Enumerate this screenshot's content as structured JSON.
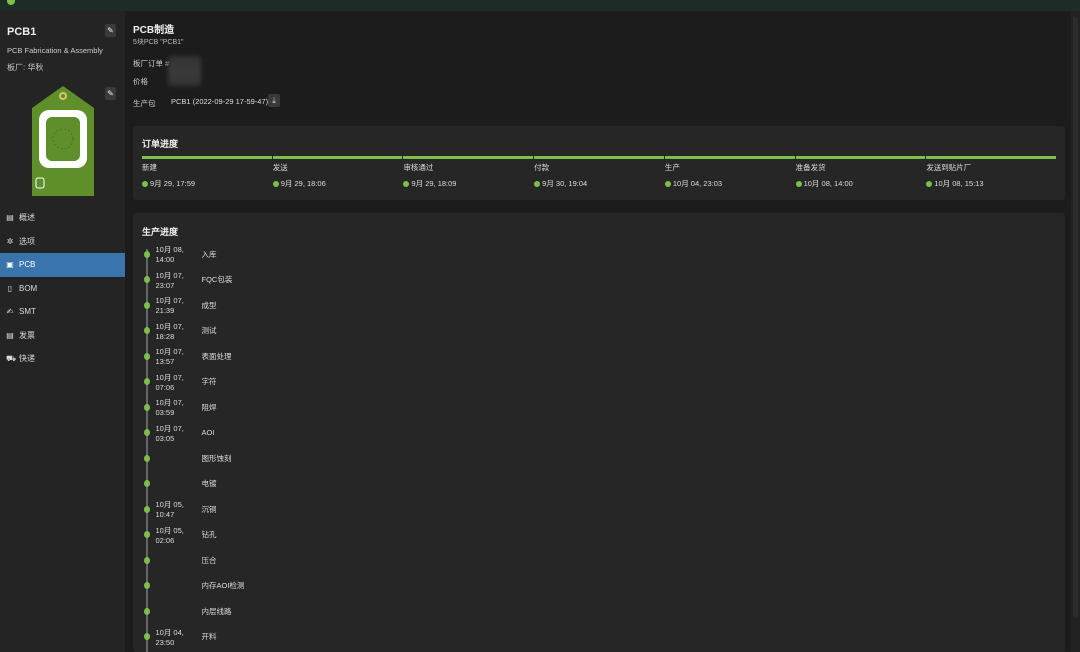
{
  "sidebar": {
    "title": "PCB1",
    "subtitle": "PCB Fabrication & Assembly",
    "fab": "板厂: 华秋",
    "items": [
      {
        "label": "概述",
        "icon": "document-icon"
      },
      {
        "label": "选项",
        "icon": "gear-icon"
      },
      {
        "label": "PCB",
        "icon": "pcb-icon",
        "active": true
      },
      {
        "label": "BOM",
        "icon": "chip-icon"
      },
      {
        "label": "SMT",
        "icon": "brush-icon"
      },
      {
        "label": "发票",
        "icon": "invoice-icon"
      },
      {
        "label": "快递",
        "icon": "truck-icon"
      }
    ]
  },
  "header": {
    "title": "PCB制造",
    "subtitle": "5块PCB \"PCB1\"",
    "order_label": "板厂订单 #",
    "price_label": "价格",
    "package_label": "生产包",
    "package_file": "PCB1 (2022-09-29 17-59-47).zip"
  },
  "order": {
    "title": "订单进度",
    "steps": [
      {
        "name": "新建",
        "time": "9月 29, 17:59"
      },
      {
        "name": "发送",
        "time": "9月 29, 18:06"
      },
      {
        "name": "审核通过",
        "time": "9月 29, 18:09"
      },
      {
        "name": "付款",
        "time": "9月 30, 19:04"
      },
      {
        "name": "生产",
        "time": "10月 04, 23:03"
      },
      {
        "name": "准备发货",
        "time": "10月 08, 14:00"
      },
      {
        "name": "发送到贴片厂",
        "time": "10月 08, 15:13"
      }
    ]
  },
  "production": {
    "title": "生产进度",
    "events": [
      {
        "time": "10月 08, 14:00",
        "name": "入库"
      },
      {
        "time": "10月 07, 23:07",
        "name": "FQC包装"
      },
      {
        "time": "10月 07, 21:39",
        "name": "成型"
      },
      {
        "time": "10月 07, 18:28",
        "name": "测试"
      },
      {
        "time": "10月 07, 13:57",
        "name": "表面处理"
      },
      {
        "time": "10月 07, 07:06",
        "name": "字符"
      },
      {
        "time": "10月 07, 03:59",
        "name": "阻焊"
      },
      {
        "time": "10月 07, 03:05",
        "name": "AOI"
      },
      {
        "time": "",
        "name": "图形蚀刻"
      },
      {
        "time": "",
        "name": "电镀"
      },
      {
        "time": "10月 05, 10:47",
        "name": "沉铜"
      },
      {
        "time": "10月 05, 02:06",
        "name": "钻孔"
      },
      {
        "time": "",
        "name": "压合"
      },
      {
        "time": "",
        "name": "内存AOI检测"
      },
      {
        "time": "",
        "name": "内层线路"
      },
      {
        "time": "10月 04, 23:50",
        "name": "开料"
      }
    ]
  },
  "colors": {
    "accent": "#7cc04b",
    "active": "#3a74ad"
  }
}
